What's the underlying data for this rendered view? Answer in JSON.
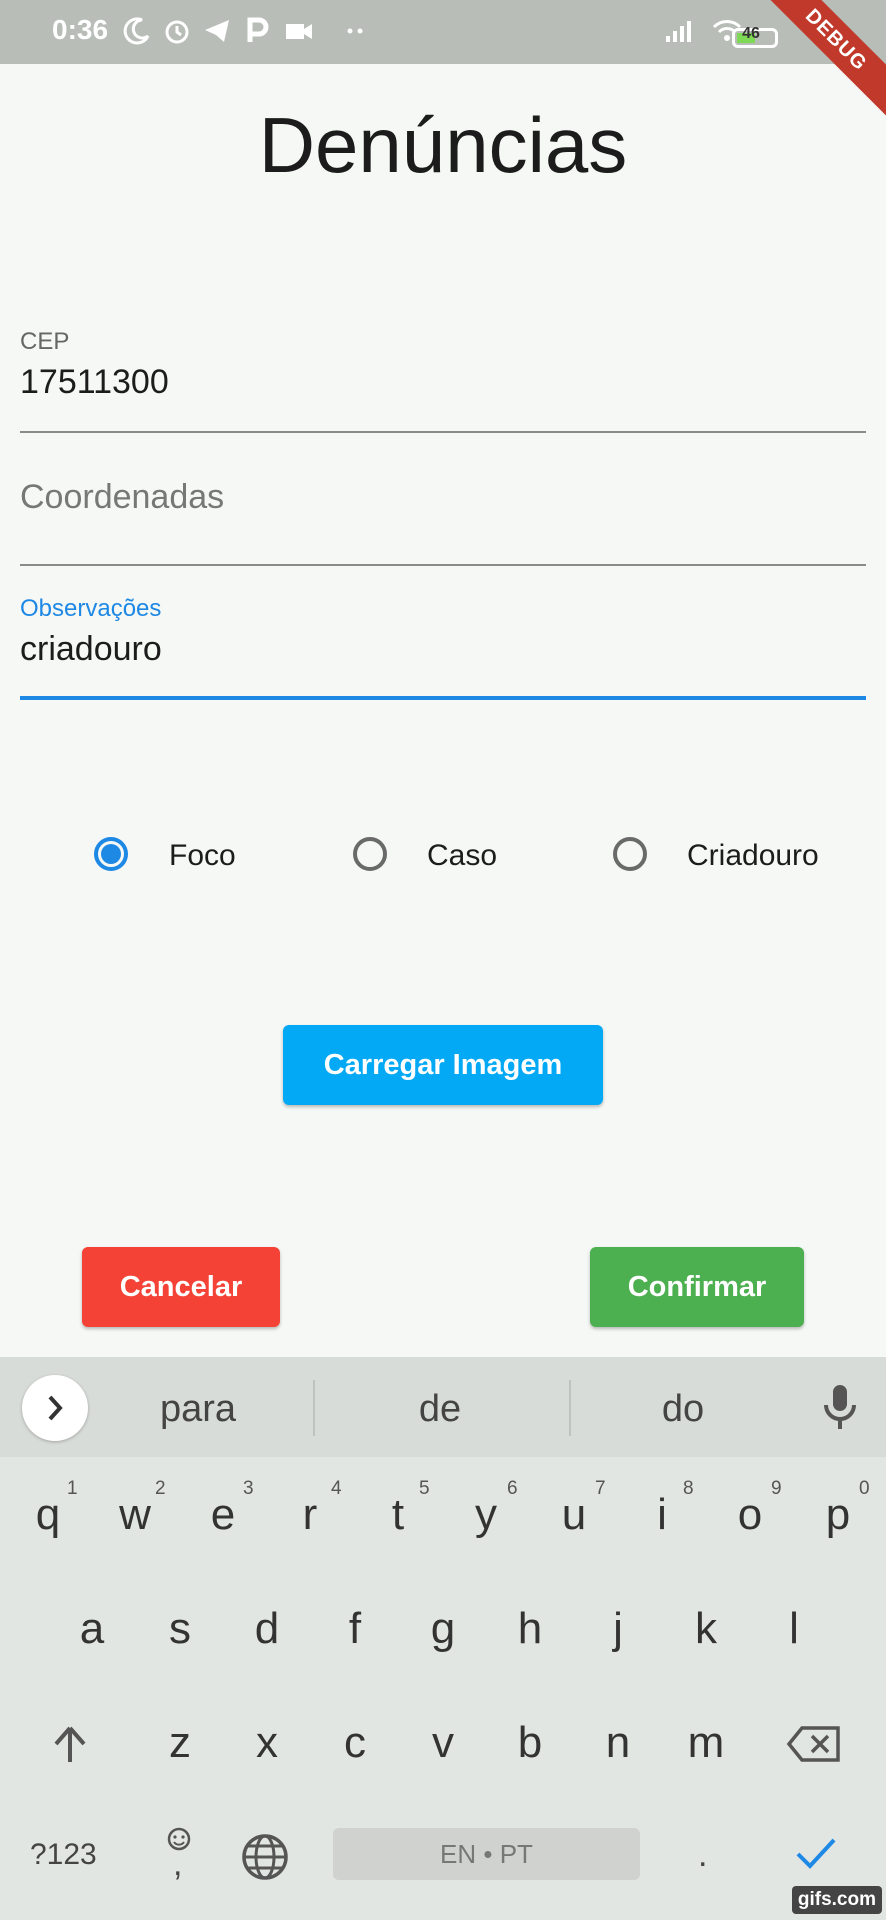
{
  "status_bar": {
    "time": "0:36",
    "battery": "46",
    "debug_banner": "DEBUG"
  },
  "page": {
    "title": "Denúncias"
  },
  "form": {
    "cep": {
      "label": "CEP",
      "value": "17511300"
    },
    "coordenadas": {
      "placeholder": "Coordenadas"
    },
    "observacoes": {
      "label": "Observações",
      "value": "criadouro"
    }
  },
  "radios": [
    {
      "label": "Foco",
      "selected": true
    },
    {
      "label": "Caso",
      "selected": false
    },
    {
      "label": "Criadouro",
      "selected": false
    }
  ],
  "buttons": {
    "upload_label": "Carregar Imagem",
    "cancel_label": "Cancelar",
    "confirm_label": "Confirmar"
  },
  "colors": {
    "accent": "#1e88e5",
    "upload": "#03a9f4",
    "cancel": "#f44336",
    "confirm": "#4caf50"
  },
  "keyboard": {
    "suggestions": [
      "para",
      "de",
      "do"
    ],
    "row1": [
      "q",
      "w",
      "e",
      "r",
      "t",
      "y",
      "u",
      "i",
      "o",
      "p"
    ],
    "row1_nums": [
      "1",
      "2",
      "3",
      "4",
      "5",
      "6",
      "7",
      "8",
      "9",
      "0"
    ],
    "row2": [
      "a",
      "s",
      "d",
      "f",
      "g",
      "h",
      "j",
      "k",
      "l"
    ],
    "row3": [
      "z",
      "x",
      "c",
      "v",
      "b",
      "n",
      "m"
    ],
    "symbols_key": "?123",
    "comma_key": ",",
    "space_label": "EN • PT",
    "period_key": "."
  },
  "watermark": "gifs.com"
}
